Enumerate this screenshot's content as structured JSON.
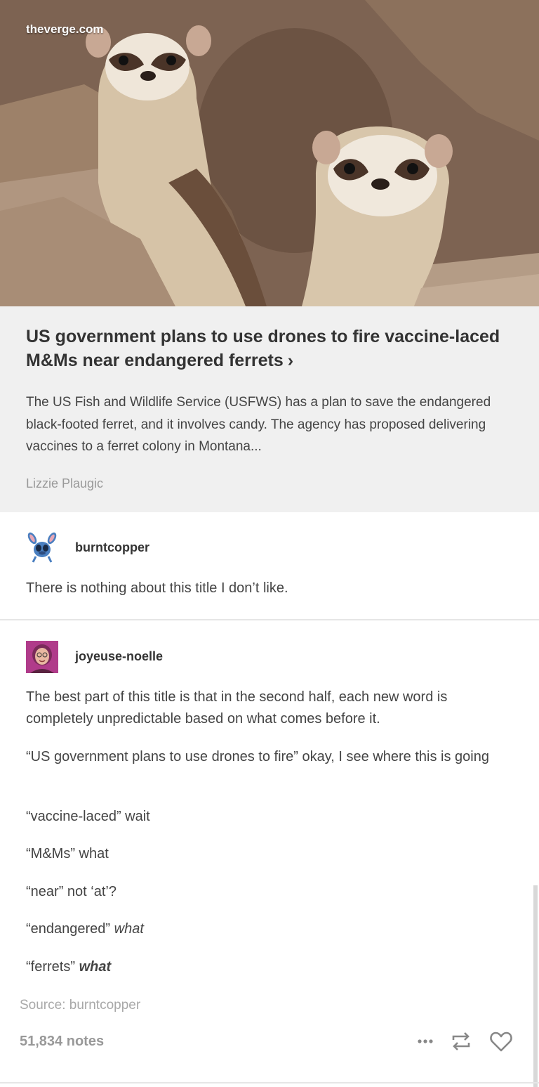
{
  "link_post": {
    "source": "theverge.com",
    "title": "US government plans to use drones to fire vaccine-laced M&Ms near endangered ferrets",
    "title_arrow": "›",
    "excerpt": "The US Fish and Wildlife Service (USFWS) has a plan to save the endangered black-footed ferret, and it involves candy. The agency has proposed delivering vaccines to a ferret colony in Montana...",
    "author": "Lizzie Plaugic",
    "image_alt": "two black-footed ferrets peeking out of a burrow"
  },
  "reblogs": [
    {
      "username": "burntcopper",
      "avatar_icon": "blue-cartoon-alien-avatar",
      "paragraphs": [
        "There is nothing about this title I don’t like."
      ]
    },
    {
      "username": "joyeuse-noelle",
      "avatar_icon": "pink-portrait-avatar",
      "paragraphs": [
        "The best part of this title is that in the second half, each new word is completely unpredictable based on what comes before it.",
        "“US government plans to use drones to fire” okay, I see where this is going",
        "“vaccine-laced” wait",
        "“M&Ms” what",
        "“near” not ‘at’?"
      ],
      "line_endangered": {
        "quote": "“endangered”",
        "reaction": "what"
      },
      "line_ferrets": {
        "quote": "“ferrets”",
        "reaction": "what"
      }
    }
  ],
  "footer": {
    "source_text": "Source: burntcopper",
    "notes": "51,834 notes",
    "icons": [
      "more-dots-icon",
      "reblog-icon",
      "heart-icon"
    ]
  },
  "colors": {
    "card_bg": "#f0f0f0",
    "text": "#333333",
    "muted": "#999999"
  }
}
